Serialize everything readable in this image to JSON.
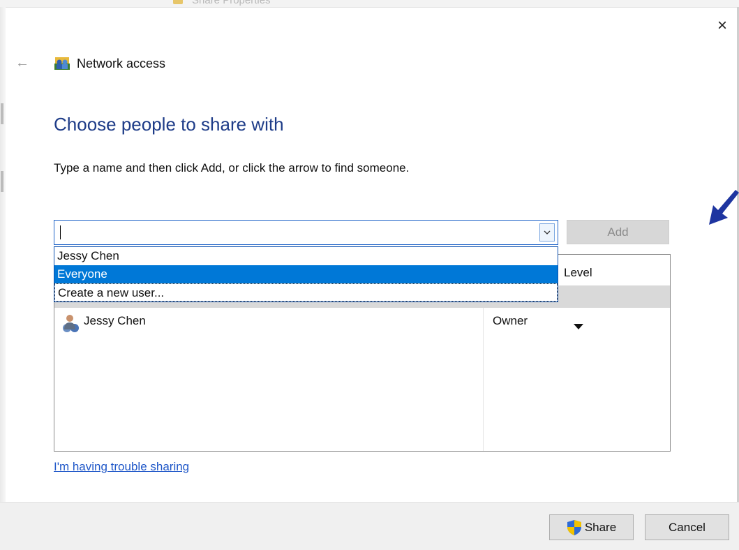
{
  "background_window": {
    "title": "Share Properties"
  },
  "dialog": {
    "close_symbol": "×",
    "back_symbol": "←",
    "header_title": "Network access",
    "heading": "Choose people to share with",
    "instruction": "Type a name and then click Add, or click the arrow to find someone.",
    "name_input": {
      "value": "",
      "placeholder": ""
    },
    "add_label": "Add",
    "dropdown": {
      "items": [
        {
          "label": "Jessy Chen",
          "selected": false
        },
        {
          "label": "Everyone",
          "selected": true
        },
        {
          "label": "Create a new user...",
          "selected": false
        }
      ]
    },
    "table": {
      "permission_header_visible": "Level",
      "rows": [
        {
          "name": "Jessy Chen",
          "level": "Owner"
        }
      ]
    },
    "trouble_link": "I'm having trouble sharing",
    "share_label": "Share",
    "cancel_label": "Cancel"
  },
  "icons": {
    "header": "network-people-icon",
    "back": "back-arrow-icon",
    "close": "close-icon",
    "combo_arrow": "chevron-down-icon",
    "user": "user-icon",
    "shield": "uac-shield-icon",
    "annotation": "blue-arrow-icon"
  },
  "colors": {
    "heading": "#1e3c88",
    "link": "#1f57c8",
    "selection": "#0078d7",
    "annotation_arrow": "#1e35a0"
  }
}
